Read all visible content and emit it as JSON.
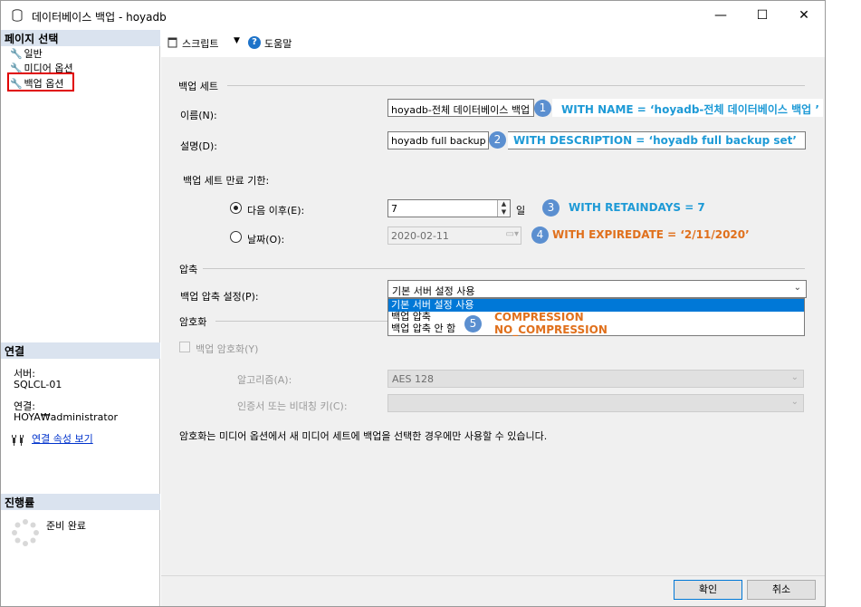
{
  "window": {
    "title": "데이터베이스 백업 - hoyadb",
    "minimize": "—",
    "maximize": "☐",
    "close": "✕"
  },
  "left": {
    "page_select_header": "페이지 선택",
    "pages": [
      {
        "label": "일반"
      },
      {
        "label": "미디어 옵션"
      },
      {
        "label": "백업 옵션"
      }
    ],
    "connection_header": "연결",
    "server_label": "서버:",
    "server_value": "SQLCL-01",
    "connection_label": "연결:",
    "connection_value": "HOYA₩administrator",
    "view_conn_props": "연결 속성 보기",
    "progress_header": "진행률",
    "progress_status": "준비 완료"
  },
  "toolbar": {
    "script": "스크립트",
    "help": "도움말"
  },
  "form": {
    "backup_set_group": "백업 세트",
    "name_label": "이름(N):",
    "name_value": "hoyadb-전체 데이터베이스 백업",
    "desc_label": "설명(D):",
    "desc_value": "hoyadb full backup set",
    "expiry_label": "백업 세트 만료 기한:",
    "after_label": "다음 이후(E):",
    "after_value": "7",
    "days_unit": "일",
    "on_label": "날짜(O):",
    "on_value": "2020-02-11",
    "compression_group": "압축",
    "compression_setting_label": "백업 압축 설정(P):",
    "compression_selected": "기본 서버 설정 사용",
    "compression_options": [
      "기본 서버 설정 사용",
      "백업 압축",
      "백업 압축 안 함"
    ],
    "encryption_group": "암호화",
    "encrypt_checkbox": "백업 암호화(Y)",
    "algorithm_label": "알고리즘(A):",
    "algorithm_value": "AES 128",
    "cert_label": "인증서 또는 비대칭 키(C):",
    "cert_value": "",
    "encryption_note": "암호화는 미디어 옵션에서 새 미디어 세트에 백업을 선택한 경우에만 사용할 수 있습니다."
  },
  "annotations": {
    "b1": "1",
    "a1": "WITH NAME = ‘hoyadb-전체 데이터베이스 백업 ’",
    "b2": "2",
    "a2": "WITH DESCRIPTION  = ‘hoyadb full backup set’",
    "b3": "3",
    "a3": "WITH RETAINDAYS  = 7",
    "b4": "4",
    "a4": "WITH EXPIREDATE  = ‘2/11/2020’",
    "b5": "5",
    "a5a": "COMPRESSION",
    "a5b": "NO_COMPRESSION"
  },
  "buttons": {
    "ok": "확인",
    "cancel": "취소"
  },
  "colors": {
    "accent": "#0078d7",
    "annotation_blue": "#1e9ad6",
    "annotation_orange": "#e0701c",
    "highlight": "#e00000"
  }
}
